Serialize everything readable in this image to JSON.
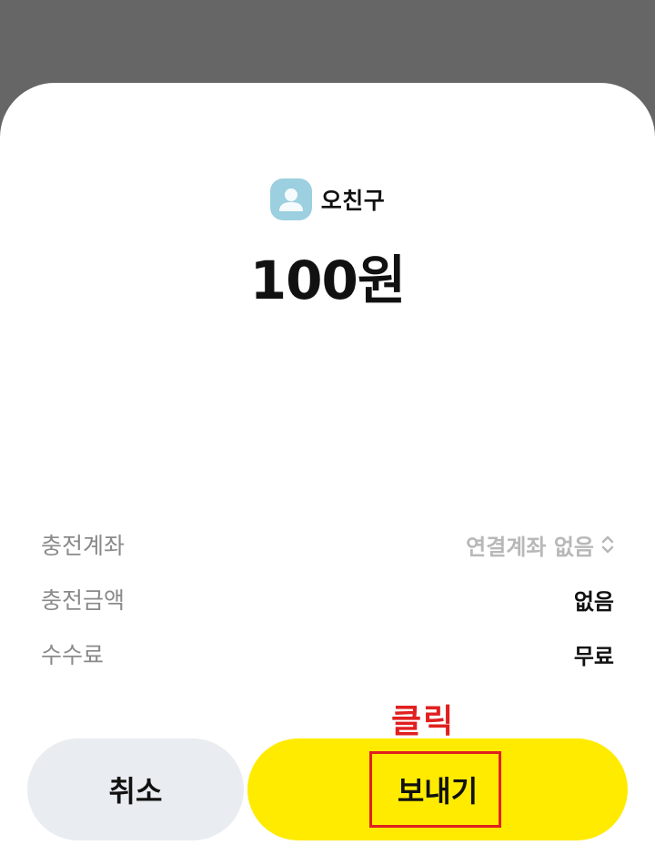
{
  "recipient": {
    "name": "오친구",
    "avatar_icon": "person-icon"
  },
  "amount": "100원",
  "details": [
    {
      "label": "충전계좌",
      "value": "연결계좌 없음",
      "has_selector": true
    },
    {
      "label": "충전금액",
      "value": "없음"
    },
    {
      "label": "수수료",
      "value": "무료"
    }
  ],
  "annotation": "클릭",
  "buttons": {
    "cancel_label": "취소",
    "send_label": "보내기"
  },
  "colors": {
    "overlay": "#666666",
    "send_button": "#ffeb00",
    "cancel_button": "#e9ecf0",
    "annotation": "#e02020",
    "avatar": "#9ccfdf"
  }
}
